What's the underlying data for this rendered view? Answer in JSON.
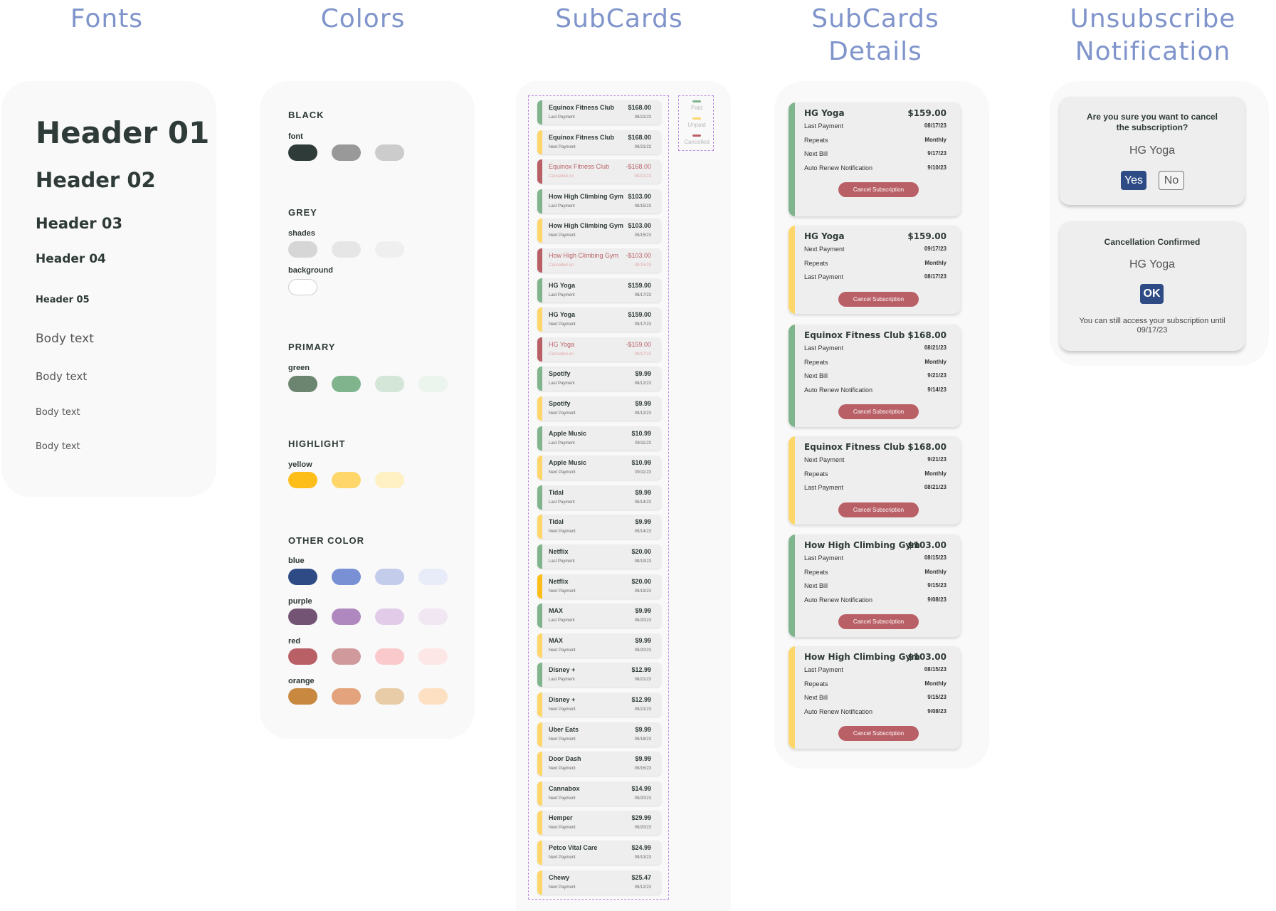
{
  "titles": {
    "fonts": "Fonts",
    "colors": "Colors",
    "subcards": "SubCards",
    "subcards_details_1": "SubCards",
    "subcards_details_2": "Details",
    "unsubscribe_1": "Unsubscribe",
    "unsubscribe_2": "Notification"
  },
  "fonts": [
    "Header 01",
    "Header 02",
    "Header 03",
    "Header 04",
    "Header 05",
    "Body text",
    "Body text",
    "Body text",
    "Body text"
  ],
  "colors": {
    "black": {
      "label": "BLACK",
      "sub": "font",
      "swatches": [
        "#2f3b38",
        "#999999",
        "#cccccc"
      ]
    },
    "grey": {
      "label": "GREY",
      "sub1": "shades",
      "sub2": "background",
      "shades": [
        "#d6d6d6",
        "#e6e6e6",
        "#efefef"
      ],
      "background": [
        "#ffffff"
      ]
    },
    "primary": {
      "label": "PRIMARY",
      "sub": "green",
      "swatches": [
        "#6b8571",
        "#7fb48c",
        "#d3e6d7",
        "#ebf4ed"
      ]
    },
    "highlight": {
      "label": "HIGHLIGHT",
      "sub": "yellow",
      "swatches": [
        "#fdbe19",
        "#fed66a",
        "#fff1c4"
      ]
    },
    "other": {
      "label": "OTHER COLOR",
      "blue": {
        "sub": "blue",
        "swatches": [
          "#2e4b85",
          "#7990d4",
          "#c4ccec",
          "#e8ebf8"
        ]
      },
      "purple": {
        "sub": "purple",
        "swatches": [
          "#735474",
          "#ae88bf",
          "#e2cbe9",
          "#f1e7f3"
        ]
      },
      "red": {
        "sub": "red",
        "swatches": [
          "#b96066",
          "#d09a9c",
          "#fac9cb",
          "#fde7e6"
        ]
      },
      "orange": {
        "sub": "orange",
        "swatches": [
          "#c8883f",
          "#e3a37c",
          "#e8cca8",
          "#fde0c2"
        ]
      }
    }
  },
  "legend": {
    "paid": "Paid",
    "unpaid": "Unpaid",
    "cancelled": "Cancelled",
    "paid_color": "#7fb48c",
    "unpaid_color": "#fed66a",
    "cancelled_color": "#b96066"
  },
  "subcards": [
    {
      "name": "Equinox Fitness Club",
      "sub": "Last Payment",
      "amount": "$168.00",
      "date": "08/21/23",
      "status": "paid"
    },
    {
      "name": "Equinox Fitness Club",
      "sub": "Next Payment",
      "amount": "$168.00",
      "date": "09/21/23",
      "status": "unpaid"
    },
    {
      "name": "Equinox Fitness Club",
      "sub": "Cancelled on",
      "amount": "-$168.00",
      "date": "09/21/23",
      "status": "cancelled"
    },
    {
      "name": "How High Climbing Gym",
      "sub": "Last Payment",
      "amount": "$103.00",
      "date": "08/15/23",
      "status": "paid"
    },
    {
      "name": "How High Climbing Gym",
      "sub": "Next Payment",
      "amount": "$103.00",
      "date": "09/15/23",
      "status": "unpaid"
    },
    {
      "name": "How High Climbing Gym",
      "sub": "Cancelled on",
      "amount": "-$103.00",
      "date": "09/15/23",
      "status": "cancelled"
    },
    {
      "name": "HG Yoga",
      "sub": "Last Payment",
      "amount": "$159.00",
      "date": "08/17/23",
      "status": "paid"
    },
    {
      "name": "HG Yoga",
      "sub": "Next Payment",
      "amount": "$159.00",
      "date": "09/17/23",
      "status": "unpaid"
    },
    {
      "name": "HG Yoga",
      "sub": "Cancelled on",
      "amount": "-$159.00",
      "date": "09/17/23",
      "status": "cancelled"
    },
    {
      "name": "Spotify",
      "sub": "Last Payment",
      "amount": "$9.99",
      "date": "08/12/23",
      "status": "paid"
    },
    {
      "name": "Spotify",
      "sub": "Next Payment",
      "amount": "$9.99",
      "date": "09/12/23",
      "status": "unpaid"
    },
    {
      "name": "Apple Music",
      "sub": "Last Payment",
      "amount": "$10.99",
      "date": "09/11/23",
      "status": "paid"
    },
    {
      "name": "Apple Music",
      "sub": "Next Payment",
      "amount": "$10.99",
      "date": "09/11/23",
      "status": "unpaid"
    },
    {
      "name": "Tidal",
      "sub": "Last Payment",
      "amount": "$9.99",
      "date": "08/14/23",
      "status": "paid"
    },
    {
      "name": "Tidal",
      "sub": "Next Payment",
      "amount": "$9.99",
      "date": "09/14/23",
      "status": "unpaid"
    },
    {
      "name": "Netflix",
      "sub": "Last Payment",
      "amount": "$20.00",
      "date": "08/19/23",
      "status": "paid"
    },
    {
      "name": "Netflix",
      "sub": "Next Payment",
      "amount": "$20.00",
      "date": "09/19/23",
      "status": "unpaid-strong"
    },
    {
      "name": "MAX",
      "sub": "Last Payment",
      "amount": "$9.99",
      "date": "08/20/23",
      "status": "paid"
    },
    {
      "name": "MAX",
      "sub": "Next Payment",
      "amount": "$9.99",
      "date": "09/20/23",
      "status": "unpaid"
    },
    {
      "name": "Disney +",
      "sub": "Last Payment",
      "amount": "$12.99",
      "date": "08/21/23",
      "status": "paid"
    },
    {
      "name": "Disney +",
      "sub": "Next Payment",
      "amount": "$12.99",
      "date": "09/21/23",
      "status": "unpaid"
    },
    {
      "name": "Uber Eats",
      "sub": "Next Payment",
      "amount": "$9.99",
      "date": "09/18/23",
      "status": "unpaid"
    },
    {
      "name": "Door Dash",
      "sub": "Next Payment",
      "amount": "$9.99",
      "date": "09/15/23",
      "status": "unpaid"
    },
    {
      "name": "Cannabox",
      "sub": "Next Payment",
      "amount": "$14.99",
      "date": "09/20/23",
      "status": "unpaid"
    },
    {
      "name": "Hemper",
      "sub": "Next Payment",
      "amount": "$29.99",
      "date": "09/20/23",
      "status": "unpaid"
    },
    {
      "name": "Petco Vital Care",
      "sub": "Next Payment",
      "amount": "$24.99",
      "date": "09/13/23",
      "status": "unpaid"
    },
    {
      "name": "Chewy",
      "sub": "Next Payment",
      "amount": "$25.47",
      "date": "09/12/23",
      "status": "unpaid"
    }
  ],
  "details": [
    {
      "title": "HG Yoga",
      "amount": "$159.00",
      "status": "paid",
      "rows": [
        [
          "Last Payment",
          "08/17/23"
        ],
        [
          "Repeats",
          "Monthly"
        ],
        [
          "Next Bill",
          "9/17/23"
        ],
        [
          "Auto Renew Notification",
          "9/10/23"
        ]
      ],
      "button": "Cancel Subscription"
    },
    {
      "title": "HG Yoga",
      "amount": "$159.00",
      "status": "unpaid",
      "rows": [
        [
          "Next Payment",
          "09/17/23"
        ],
        [
          "Repeats",
          "Monthly"
        ],
        [
          "Last Payment",
          "08/17/23"
        ]
      ],
      "button": "Cancel Subscription"
    },
    {
      "title": "Equinox Fitness Club",
      "amount": "$168.00",
      "status": "paid",
      "rows": [
        [
          "Last Payment",
          "08/21/23"
        ],
        [
          "Repeats",
          "Monthly"
        ],
        [
          "Next Bill",
          "9/21/23"
        ],
        [
          "Auto Renew Notification",
          "9/14/23"
        ]
      ],
      "button": "Cancel Subscription"
    },
    {
      "title": "Equinox Fitness Club",
      "amount": "$168.00",
      "status": "unpaid",
      "rows": [
        [
          "Next Payment",
          "9/21/23"
        ],
        [
          "Repeats",
          "Monthly"
        ],
        [
          "Last Payment",
          "08/21/23"
        ]
      ],
      "button": "Cancel Subscription"
    },
    {
      "title": "How High Climbing Gym",
      "amount": "$103.00",
      "status": "paid",
      "rows": [
        [
          "Last Payment",
          "08/15/23"
        ],
        [
          "Repeats",
          "Monthly"
        ],
        [
          "Next Bill",
          "9/15/23"
        ],
        [
          "Auto Renew Notification",
          "9/08/23"
        ]
      ],
      "button": "Cancel Subscription"
    },
    {
      "title": "How High Climbing Gym",
      "amount": "$103.00",
      "status": "unpaid",
      "rows": [
        [
          "Last Payment",
          "08/15/23"
        ],
        [
          "Repeats",
          "Monthly"
        ],
        [
          "Next Bill",
          "9/15/23"
        ],
        [
          "Auto Renew Notification",
          "9/08/23"
        ]
      ],
      "button": "Cancel Subscription"
    }
  ],
  "notify": {
    "confirm_question": "Are you sure you want to cancel the subscription?",
    "confirm_name": "HG Yoga",
    "yes": "Yes",
    "no": "No",
    "done_title": "Cancellation Confirmed",
    "done_name": "HG Yoga",
    "ok": "OK",
    "done_note": "You can still access your subscription until 09/17/23"
  },
  "status_colors": {
    "paid": "#7fb48c",
    "unpaid": "#fed66a",
    "unpaid-strong": "#fdbe19",
    "cancelled": "#b96066"
  }
}
